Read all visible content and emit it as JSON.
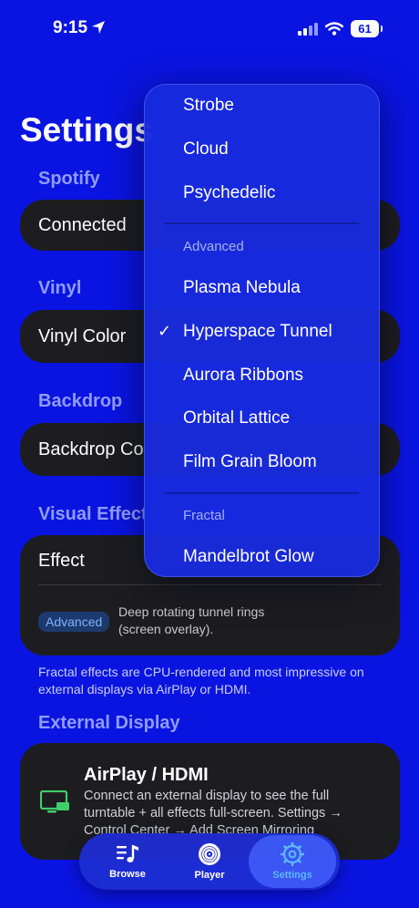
{
  "status": {
    "time": "9:15",
    "battery": "61"
  },
  "page_title": "Settings",
  "sections": {
    "spotify": {
      "label": "Spotify",
      "row": "Connected"
    },
    "vinyl": {
      "label": "Vinyl",
      "row": "Vinyl Color"
    },
    "backdrop": {
      "label": "Backdrop",
      "row": "Backdrop Co"
    },
    "visual": {
      "label": "Visual Effect",
      "row": "Effect",
      "badge": "Advanced",
      "description": "Deep rotating tunnel rings (screen overlay).",
      "footnote": "Fractal effects are CPU-rendered and most impressive on external displays via AirPlay or HDMI."
    },
    "external": {
      "label": "External Display",
      "title": "AirPlay / HDMI",
      "description": "Connect an external display to see the full turntable + all effects full-screen. Settings → Control Center → Add Screen Mirroring"
    }
  },
  "menu": {
    "items_top": [
      "Strobe",
      "Cloud",
      "Psychedelic"
    ],
    "header_advanced": "Advanced",
    "items_advanced": [
      "Plasma Nebula",
      "Hyperspace Tunnel",
      "Aurora Ribbons",
      "Orbital Lattice",
      "Film Grain Bloom"
    ],
    "selected": "Hyperspace Tunnel",
    "check": "✓",
    "header_fractal": "Fractal",
    "items_fractal": [
      "Mandelbrot Glow"
    ]
  },
  "tabs": [
    {
      "label": "Browse",
      "icon": "music-list-icon"
    },
    {
      "label": "Player",
      "icon": "vinyl-disc-icon"
    },
    {
      "label": "Settings",
      "icon": "gear-icon",
      "active": true
    }
  ],
  "colors": {
    "background": "#0a14e0",
    "card": "#1d1d20",
    "accent": "#5eb8ff",
    "section_label": "#8f9bff"
  }
}
